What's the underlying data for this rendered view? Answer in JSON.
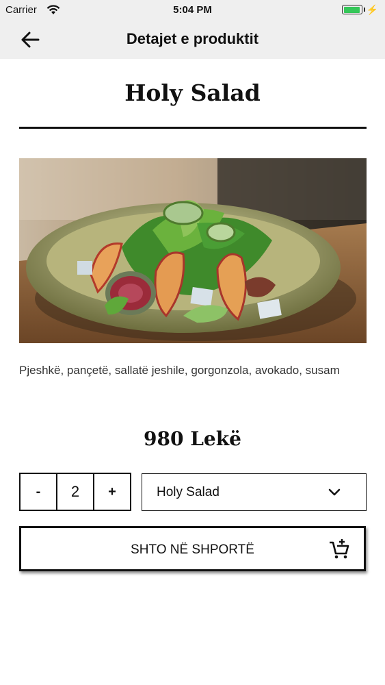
{
  "status_bar": {
    "carrier": "Carrier",
    "time": "5:04 PM"
  },
  "nav": {
    "title": "Detajet e produktit",
    "back_icon": "arrow-left"
  },
  "product": {
    "name": "Holy Salad",
    "description": "Pjeshkë, pançetë, sallatë jeshile, gorgonzola, avokado, susam",
    "price": "980 Lekë"
  },
  "quantity": {
    "minus_label": "-",
    "value": "2",
    "plus_label": "+"
  },
  "variant_select": {
    "selected": "Holy Salad"
  },
  "add_to_cart": {
    "label": "SHTO NË SHPORTË",
    "icon": "add-shopping-cart"
  },
  "colors": {
    "bar_bg": "#efefef",
    "battery": "#35c759",
    "text": "#111111"
  }
}
